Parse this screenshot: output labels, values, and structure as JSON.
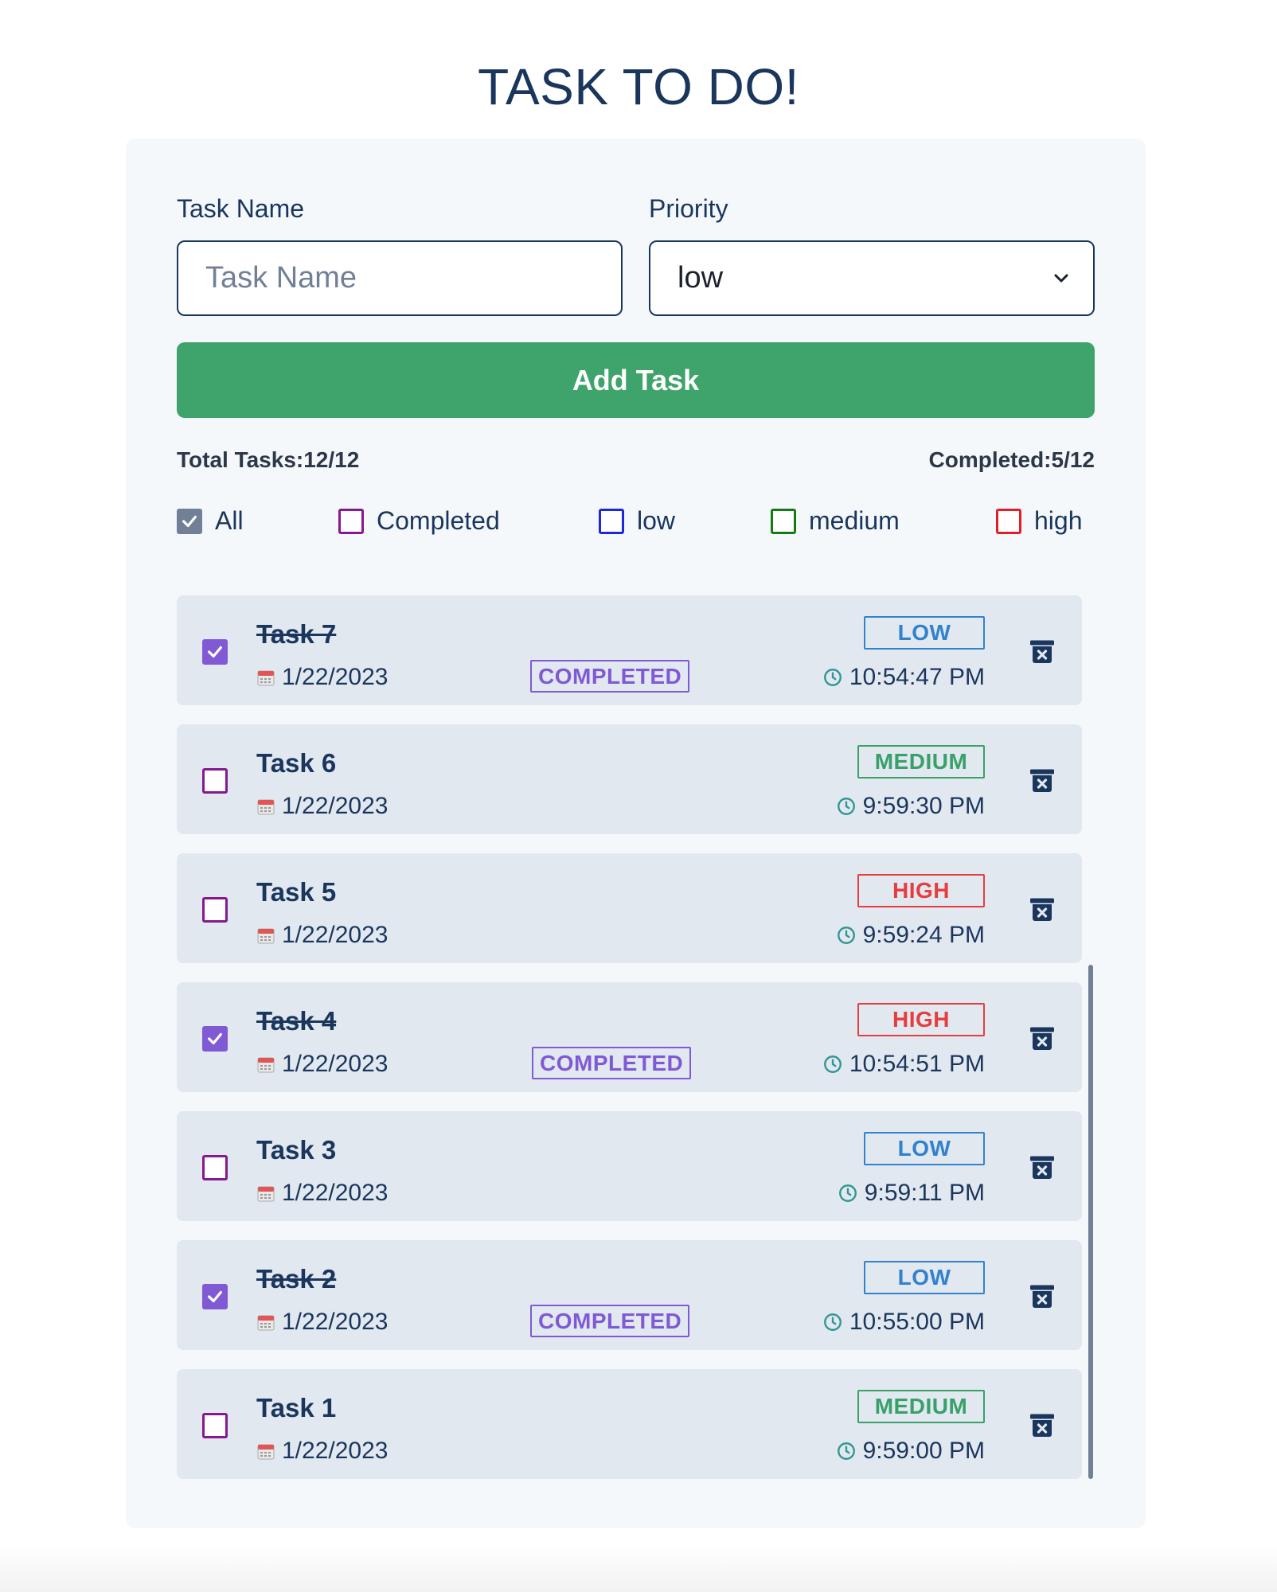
{
  "title": "TASK TO DO!",
  "form": {
    "task_name_label": "Task Name",
    "task_name_placeholder": "Task Name",
    "priority_label": "Priority",
    "priority_value": "low",
    "add_button": "Add Task"
  },
  "stats": {
    "total": "Total Tasks:12/12",
    "completed": "Completed:5/12"
  },
  "filters": [
    {
      "label": "All",
      "checked": true,
      "color": "#718096"
    },
    {
      "label": "Completed",
      "checked": false,
      "color": "#86198f"
    },
    {
      "label": "low",
      "checked": false,
      "color": "#1d27e0"
    },
    {
      "label": "medium",
      "checked": false,
      "color": "#157a15"
    },
    {
      "label": "high",
      "checked": false,
      "color": "#e11d28"
    }
  ],
  "tasks": [
    {
      "name": "Task 7",
      "date": "1/22/2023",
      "priority": "LOW",
      "time": "10:54:47 PM",
      "done": true,
      "done_label": "COMPLETED"
    },
    {
      "name": "Task 6",
      "date": "1/22/2023",
      "priority": "MEDIUM",
      "time": "9:59:30 PM",
      "done": false
    },
    {
      "name": "Task 5",
      "date": "1/22/2023",
      "priority": "HIGH",
      "time": "9:59:24 PM",
      "done": false
    },
    {
      "name": "Task 4",
      "date": "1/22/2023",
      "priority": "HIGH",
      "time": "10:54:51 PM",
      "done": true,
      "done_label": "COMPLETED"
    },
    {
      "name": "Task 3",
      "date": "1/22/2023",
      "priority": "LOW",
      "time": "9:59:11 PM",
      "done": false
    },
    {
      "name": "Task 2",
      "date": "1/22/2023",
      "priority": "LOW",
      "time": "10:55:00 PM",
      "done": true,
      "done_label": "COMPLETED"
    },
    {
      "name": "Task 1",
      "date": "1/22/2023",
      "priority": "MEDIUM",
      "time": "9:59:00 PM",
      "done": false
    }
  ],
  "colors": {
    "primary_text": "#1a365d",
    "add_button": "#3fa36c",
    "completed_accent": "#805ad5",
    "low": "#3182ce",
    "medium": "#38a169",
    "high": "#e53e3e",
    "card_bg": "#f5f8fb",
    "task_bg": "#e2e8f0"
  },
  "icons": {
    "date": "calendar-icon",
    "time": "clock-icon",
    "delete": "trash-icon",
    "select": "chevron-down-icon"
  }
}
